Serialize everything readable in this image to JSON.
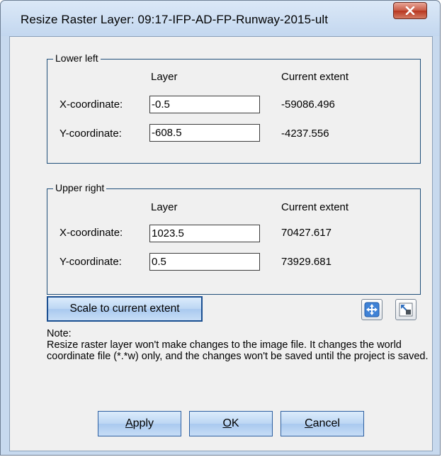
{
  "window": {
    "title": "Resize Raster Layer: 09:17-IFP-AD-FP-Runway-2015-ult",
    "close_glyph": "X"
  },
  "lower_left": {
    "legend": "Lower left",
    "col_layer": "Layer",
    "col_extent": "Current extent",
    "x_label": "X-coordinate:",
    "x_value": "-0.5",
    "x_extent": "-59086.496",
    "y_label": "Y-coordinate:",
    "y_value": "-608.5",
    "y_extent": "-4237.556"
  },
  "upper_right": {
    "legend": "Upper right",
    "col_layer": "Layer",
    "col_extent": "Current extent",
    "x_label": "X-coordinate:",
    "x_value": "1023.5",
    "x_extent": "70427.617",
    "y_label": "Y-coordinate:",
    "y_value": "0.5",
    "y_extent": "73929.681"
  },
  "scale_button": "Scale to current extent",
  "note": {
    "heading": "Note:",
    "body": "Resize raster layer won't make changes to the image file.  It changes the world coordinate file (*.*w) only, and the changes won't be saved until the project is saved."
  },
  "buttons": {
    "apply_first": "A",
    "apply_rest": "pply",
    "ok_first": "O",
    "ok_rest": "K",
    "cancel_first": "C",
    "cancel_rest": "ancel"
  },
  "icons": {
    "move": "move-arrows-icon",
    "resize": "resize-corner-icon"
  }
}
